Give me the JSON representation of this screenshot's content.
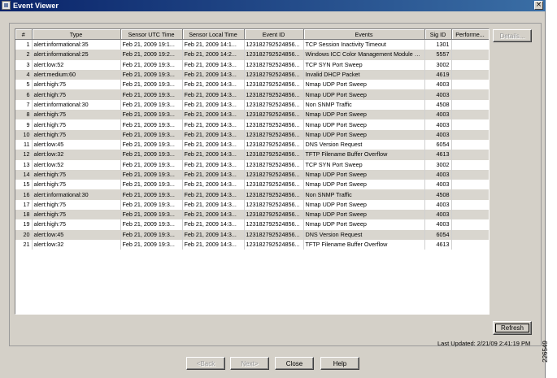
{
  "window": {
    "title": "Event Viewer",
    "close_glyph": "×"
  },
  "table": {
    "columns": [
      "#",
      "Type",
      "Sensor UTC Time",
      "Sensor Local Time",
      "Event ID",
      "Events",
      "Sig ID",
      "Performe..."
    ],
    "rows": [
      [
        "1",
        "alert:informational:35",
        "Feb 21, 2009 19:1...",
        "Feb 21, 2009 14:1...",
        "123182792524856...",
        "TCP Session Inactivity Timeout",
        "1301",
        ""
      ],
      [
        "2",
        "alert:informational:25",
        "Feb 21, 2009 19:2...",
        "Feb 21, 2009 14:2...",
        "123182792524856...",
        "Windows ICC Color Management Module Vul.",
        "5557",
        ""
      ],
      [
        "3",
        "alert:low:52",
        "Feb 21, 2009 19:3...",
        "Feb 21, 2009 14:3...",
        "123182792524856...",
        "TCP SYN Port Sweep",
        "3002",
        ""
      ],
      [
        "4",
        "alert:medium:60",
        "Feb 21, 2009 19:3...",
        "Feb 21, 2009 14:3...",
        "123182792524856...",
        "Invalid DHCP Packet",
        "4619",
        ""
      ],
      [
        "5",
        "alert:high:75",
        "Feb 21, 2009 19:3...",
        "Feb 21, 2009 14:3...",
        "123182792524856...",
        "Nmap UDP Port Sweep",
        "4003",
        ""
      ],
      [
        "6",
        "alert:high:75",
        "Feb 21, 2009 19:3...",
        "Feb 21, 2009 14:3...",
        "123182792524856...",
        "Nmap UDP Port Sweep",
        "4003",
        ""
      ],
      [
        "7",
        "alert:informational:30",
        "Feb 21, 2009 19:3...",
        "Feb 21, 2009 14:3...",
        "123182792524856...",
        "Non SNMP Traffic",
        "4508",
        ""
      ],
      [
        "8",
        "alert:high:75",
        "Feb 21, 2009 19:3...",
        "Feb 21, 2009 14:3...",
        "123182792524856...",
        "Nmap UDP Port Sweep",
        "4003",
        ""
      ],
      [
        "9",
        "alert:high:75",
        "Feb 21, 2009 19:3...",
        "Feb 21, 2009 14:3...",
        "123182792524856...",
        "Nmap UDP Port Sweep",
        "4003",
        ""
      ],
      [
        "10",
        "alert:high:75",
        "Feb 21, 2009 19:3...",
        "Feb 21, 2009 14:3...",
        "123182792524856...",
        "Nmap UDP Port Sweep",
        "4003",
        ""
      ],
      [
        "11",
        "alert:low:45",
        "Feb 21, 2009 19:3...",
        "Feb 21, 2009 14:3...",
        "123182792524856...",
        "DNS Version Request",
        "6054",
        ""
      ],
      [
        "12",
        "alert:low:32",
        "Feb 21, 2009 19:3...",
        "Feb 21, 2009 14:3...",
        "123182792524856...",
        "TFTP Filename Buffer Overflow",
        "4613",
        ""
      ],
      [
        "13",
        "alert:low:52",
        "Feb 21, 2009 19:3...",
        "Feb 21, 2009 14:3...",
        "123182792524856...",
        "TCP SYN Port Sweep",
        "3002",
        ""
      ],
      [
        "14",
        "alert:high:75",
        "Feb 21, 2009 19:3...",
        "Feb 21, 2009 14:3...",
        "123182792524856...",
        "Nmap UDP Port Sweep",
        "4003",
        ""
      ],
      [
        "15",
        "alert:high:75",
        "Feb 21, 2009 19:3...",
        "Feb 21, 2009 14:3...",
        "123182792524856...",
        "Nmap UDP Port Sweep",
        "4003",
        ""
      ],
      [
        "16",
        "alert:informational:30",
        "Feb 21, 2009 19:3...",
        "Feb 21, 2009 14:3...",
        "123182792524856...",
        "Non SNMP Traffic",
        "4508",
        ""
      ],
      [
        "17",
        "alert:high:75",
        "Feb 21, 2009 19:3...",
        "Feb 21, 2009 14:3...",
        "123182792524856...",
        "Nmap UDP Port Sweep",
        "4003",
        ""
      ],
      [
        "18",
        "alert:high:75",
        "Feb 21, 2009 19:3...",
        "Feb 21, 2009 14:3...",
        "123182792524856...",
        "Nmap UDP Port Sweep",
        "4003",
        ""
      ],
      [
        "19",
        "alert:high:75",
        "Feb 21, 2009 19:3...",
        "Feb 21, 2009 14:3...",
        "123182792524856...",
        "Nmap UDP Port Sweep",
        "4003",
        ""
      ],
      [
        "20",
        "alert:low:45",
        "Feb 21, 2009 19:3...",
        "Feb 21, 2009 14:3...",
        "123182792524856...",
        "DNS Version Request",
        "6054",
        ""
      ],
      [
        "21",
        "alert:low:32",
        "Feb 21, 2009 19:3...",
        "Feb 21, 2009 14:3...",
        "123182792524856...",
        "TFTP Filename Buffer Overflow",
        "4613",
        ""
      ]
    ]
  },
  "buttons": {
    "details": "Details...",
    "refresh": "Refresh",
    "back": "<Back",
    "next": "Next>",
    "close": "Close",
    "help": "Help"
  },
  "status": {
    "last_updated": "Last Updated: 2/21/09 2:41:19 PM"
  },
  "figure_id": "226549",
  "colors": {
    "title_start": "#0a246a",
    "title_end": "#3a6ea5",
    "alt_row": "#d9d6cf",
    "window_bg": "#d4d0c8"
  }
}
